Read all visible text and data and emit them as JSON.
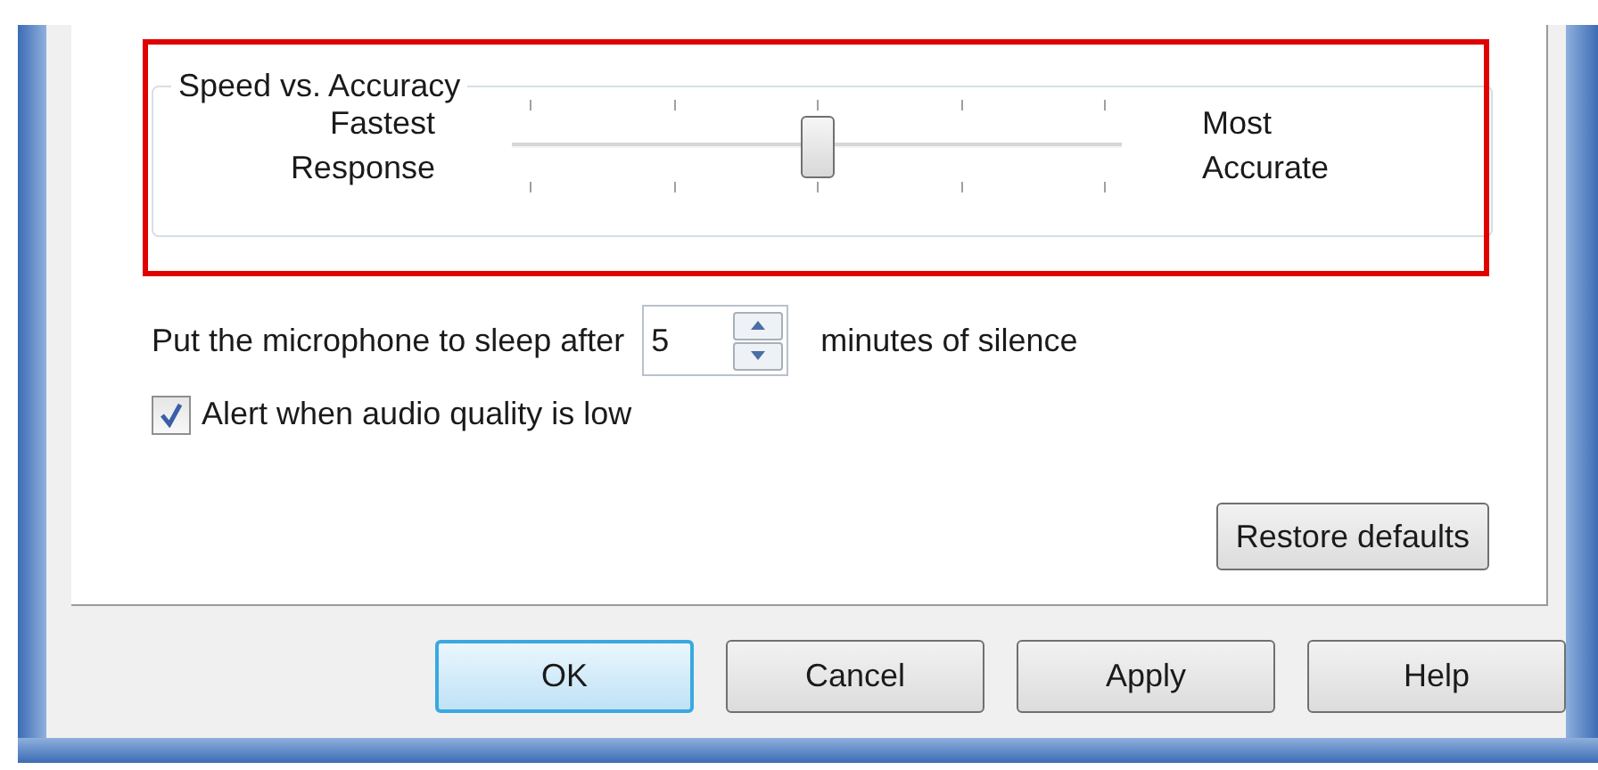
{
  "speed_group": {
    "title": "Speed vs. Accuracy",
    "left_label": [
      "Fastest",
      "Response"
    ],
    "right_label": [
      "Most",
      "Accurate"
    ],
    "slider": {
      "level": 0.5
    }
  },
  "sleep": {
    "label": "Put the microphone to sleep after",
    "value": "5",
    "suffix": "minutes of silence"
  },
  "alert": {
    "label": "Alert when audio quality is low",
    "checked": true
  },
  "restore_button": "Restore defaults",
  "buttons": [
    {
      "label": "OK",
      "default": true
    },
    {
      "label": "Cancel",
      "default": false
    },
    {
      "label": "Apply",
      "default": false
    },
    {
      "label": "Help",
      "default": false
    }
  ]
}
